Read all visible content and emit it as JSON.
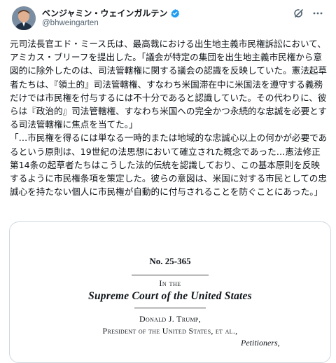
{
  "author": {
    "display_name": "ベンジャミン・ウェインガルテン",
    "handle": "@bhweingarten",
    "verified_color": "#1d9bf0"
  },
  "tweet": {
    "paragraphs": [
      "元司法長官エド・ミース氏は、最高裁における出生地主義市民権訴訟において、アミカス・ブリーフを提出した。「議会が特定の集団を出生地主義市民権から意図的に除外したのは、司法管轄権に関する議会の認識を反映していた。憲法起草者たちは、『領土的』司法管轄権、すなわち米国滞在中に米国法を遵守する義務だけでは市民権を付与するには不十分であると認識していた。その代わりに、彼らは『政治的』司法管轄権、すなわち米国への完全かつ永続的な忠誠を必要とする司法管轄権に焦点を当てた。」",
      "「…市民権を得るには単なる一時的または地域的な忠誠心以上の何かが必要であるという原則は、19世紀の法思想において確立された概念であった…憲法修正第14条の起草者たちはこうした法的伝統を認識しており、この基本原則を反映するように市民権条項を策定した。彼らの意図は、米国に対する市民としての忠誠心を持たない個人に市民権が自動的に付与されることを防ぐことにあった。」"
    ]
  },
  "document": {
    "number": "No. 25-365",
    "in_the": "In the",
    "court": "Supreme Court of the United States",
    "party": "Donald J. Trump,",
    "party_title": "President of the United States, et al.,",
    "role": "Petitioners,"
  },
  "icons": {
    "grok": "grok-icon",
    "more": "more-options-icon",
    "verified": "verified-badge-icon"
  }
}
